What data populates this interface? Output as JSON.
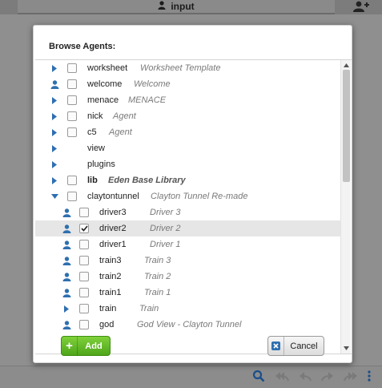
{
  "header": {
    "tab_label": "input"
  },
  "dialog": {
    "title": "Browse Agents:",
    "add_label": "Add",
    "cancel_label": "Cancel"
  },
  "colors": {
    "accent_blue": "#2f6fb0",
    "add_green": "#5cb526",
    "selected_row": "#e6e6e6"
  },
  "agents": [
    {
      "lead": "triangle-right",
      "checkbox": true,
      "checked": false,
      "name": "worksheet",
      "desc": "Worksheet Template",
      "indent": 0,
      "bold": false
    },
    {
      "lead": "user",
      "checkbox": true,
      "checked": false,
      "name": "welcome",
      "desc": "Welcome",
      "indent": 0,
      "bold": false
    },
    {
      "lead": "triangle-right",
      "checkbox": true,
      "checked": false,
      "name": "menace",
      "desc": "MENACE",
      "indent": 0,
      "bold": false
    },
    {
      "lead": "triangle-right",
      "checkbox": true,
      "checked": false,
      "name": "nick",
      "desc": "Agent",
      "indent": 0,
      "bold": false
    },
    {
      "lead": "triangle-right",
      "checkbox": true,
      "checked": false,
      "name": "c5",
      "desc": "Agent",
      "indent": 0,
      "bold": false
    },
    {
      "lead": "triangle-right",
      "checkbox": false,
      "checked": false,
      "name": "view",
      "desc": "",
      "indent": 0,
      "bold": false
    },
    {
      "lead": "triangle-right",
      "checkbox": false,
      "checked": false,
      "name": "plugins",
      "desc": "",
      "indent": 0,
      "bold": false
    },
    {
      "lead": "triangle-right",
      "checkbox": true,
      "checked": false,
      "name": "lib",
      "desc": "Eden Base Library",
      "indent": 0,
      "bold": true
    },
    {
      "lead": "triangle-down",
      "checkbox": true,
      "checked": false,
      "name": "claytontunnel",
      "desc": "Clayton Tunnel Re-made",
      "indent": 0,
      "bold": false
    },
    {
      "lead": "user",
      "checkbox": true,
      "checked": false,
      "name": "driver3",
      "desc": "Driver 3",
      "indent": 1,
      "bold": false
    },
    {
      "lead": "user",
      "checkbox": true,
      "checked": true,
      "name": "driver2",
      "desc": "Driver 2",
      "indent": 1,
      "bold": false,
      "selected": true
    },
    {
      "lead": "user",
      "checkbox": true,
      "checked": false,
      "name": "driver1",
      "desc": "Driver 1",
      "indent": 1,
      "bold": false
    },
    {
      "lead": "user",
      "checkbox": true,
      "checked": false,
      "name": "train3",
      "desc": "Train 3",
      "indent": 1,
      "bold": false
    },
    {
      "lead": "user",
      "checkbox": true,
      "checked": false,
      "name": "train2",
      "desc": "Train 2",
      "indent": 1,
      "bold": false
    },
    {
      "lead": "user",
      "checkbox": true,
      "checked": false,
      "name": "train1",
      "desc": "Train 1",
      "indent": 1,
      "bold": false
    },
    {
      "lead": "triangle-right",
      "checkbox": true,
      "checked": false,
      "name": "train",
      "desc": "Train",
      "indent": 1,
      "bold": false
    },
    {
      "lead": "user",
      "checkbox": true,
      "checked": false,
      "name": "god",
      "desc": "God View - Clayton Tunnel",
      "indent": 1,
      "bold": false
    }
  ]
}
